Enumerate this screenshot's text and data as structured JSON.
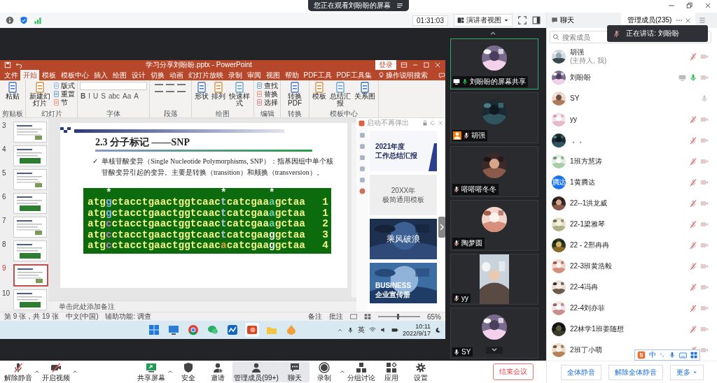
{
  "header": {
    "banner": "您正在观看刘盼盼的屏幕"
  },
  "meeting_bar": {
    "timer": "01:31:03",
    "view_mode": "演讲者视图"
  },
  "ppt": {
    "title": "学习分享刘盼盼.pptx - PowerPoint",
    "sign_in": "登录",
    "tabs": [
      {
        "label": "文件",
        "selected": false
      },
      {
        "label": "开始",
        "selected": true
      },
      {
        "label": "模板",
        "selected": false
      },
      {
        "label": "模板中心",
        "selected": false
      },
      {
        "label": "插入",
        "selected": false
      },
      {
        "label": "绘图",
        "selected": false
      },
      {
        "label": "设计",
        "selected": false
      },
      {
        "label": "切换",
        "selected": false
      },
      {
        "label": "动画",
        "selected": false
      },
      {
        "label": "幻灯片放映",
        "selected": false
      },
      {
        "label": "录制",
        "selected": false
      },
      {
        "label": "审阅",
        "selected": false
      },
      {
        "label": "视图",
        "selected": false
      },
      {
        "label": "帮助",
        "selected": false
      },
      {
        "label": "PDF工具",
        "selected": false
      },
      {
        "label": "PDF工具集",
        "selected": false
      }
    ],
    "tell_me": "操作说明搜索",
    "ribbon": [
      {
        "label": "剪贴板",
        "buttons": [
          {
            "label": "粘贴",
            "kind": "large"
          }
        ]
      },
      {
        "label": "幻灯片",
        "buttons": [
          {
            "label": "新建幻灯片",
            "kind": "large"
          },
          {
            "label": "版式",
            "kind": "small"
          },
          {
            "label": "重置",
            "kind": "small"
          },
          {
            "label": "节",
            "kind": "small"
          }
        ]
      },
      {
        "label": "字体",
        "buttons": [
          {
            "label": "B",
            "kind": "glyph"
          },
          {
            "label": "I",
            "kind": "glyph"
          },
          {
            "label": "U",
            "kind": "glyph"
          },
          {
            "label": "S",
            "kind": "glyph"
          },
          {
            "label": "abc",
            "kind": "glyph"
          },
          {
            "label": "Aa",
            "kind": "glyph"
          },
          {
            "label": "A",
            "kind": "glyph"
          }
        ]
      },
      {
        "label": "段落"
      },
      {
        "label": "绘图",
        "buttons": [
          {
            "label": "形状",
            "kind": "large"
          },
          {
            "label": "排列",
            "kind": "large"
          },
          {
            "label": "快速样式",
            "kind": "large"
          }
        ]
      },
      {
        "label": "编辑",
        "buttons": [
          {
            "label": "查找",
            "kind": "small"
          },
          {
            "label": "替换",
            "kind": "small"
          },
          {
            "label": "选择",
            "kind": "small"
          }
        ]
      },
      {
        "label": "转换",
        "buttons": [
          {
            "label": "转换PDF",
            "kind": "large"
          }
        ]
      },
      {
        "label": "模板中心",
        "buttons": [
          {
            "label": "模板",
            "kind": "large"
          },
          {
            "label": "总结汇报",
            "kind": "large"
          },
          {
            "label": "关系图",
            "kind": "large"
          }
        ]
      }
    ],
    "thumbnails": [
      {
        "number": "3",
        "selected": false
      },
      {
        "number": "4",
        "selected": false
      },
      {
        "number": "5",
        "selected": false
      },
      {
        "number": "6",
        "selected": false
      },
      {
        "number": "7",
        "selected": false
      },
      {
        "number": "8",
        "selected": false
      },
      {
        "number": "9",
        "selected": true
      },
      {
        "number": "10",
        "selected": false
      }
    ],
    "slide": {
      "title": "2.3 分子标记 ——SNP",
      "bullet": "✓",
      "text": "单核苷酸变异（Single Nucleotide Polymorphisms, SNP）：指基因组中单个核苷酸变异引起的变异。主要是转换（transition）和颠换（transversion）。",
      "marker_row": "   *                  *       *",
      "sequences": [
        {
          "number": "1",
          "segments": [
            {
              "text": "atg"
            },
            {
              "text": "g",
              "color": "#8ab4f8"
            },
            {
              "text": "ctacctgaactggtcaac"
            },
            {
              "text": "t",
              "color": "#b0c4de"
            },
            {
              "text": "catcgaa"
            },
            {
              "text": "a",
              "color": "#66cdaa"
            },
            {
              "text": "gctaa"
            }
          ]
        },
        {
          "number": "1",
          "segments": [
            {
              "text": "atg"
            },
            {
              "text": "g",
              "color": "#8ab4f8"
            },
            {
              "text": "ctacctgaactggtcaac"
            },
            {
              "text": "t",
              "color": "#b0c4de"
            },
            {
              "text": "catcgaa"
            },
            {
              "text": "a",
              "color": "#66cdaa"
            },
            {
              "text": "gctaa"
            }
          ]
        },
        {
          "number": "2",
          "segments": [
            {
              "text": "atg"
            },
            {
              "text": "c",
              "color": "#b07cc6"
            },
            {
              "text": "ctacctgaactggtcaac"
            },
            {
              "text": "t",
              "color": "#b0c4de"
            },
            {
              "text": "catcgaa"
            },
            {
              "text": "a",
              "color": "#66cdaa"
            },
            {
              "text": "gctaa"
            }
          ]
        },
        {
          "number": "3",
          "segments": [
            {
              "text": "atg"
            },
            {
              "text": "c",
              "color": "#b07cc6"
            },
            {
              "text": "ctacctgaactggtcaac"
            },
            {
              "text": "t",
              "color": "#b0c4de"
            },
            {
              "text": "catcgaa"
            },
            {
              "text": "g",
              "color": "#f4f4f4"
            },
            {
              "text": "gctaa"
            }
          ]
        },
        {
          "number": "4",
          "segments": [
            {
              "text": "atg"
            },
            {
              "text": "c",
              "color": "#b07cc6"
            },
            {
              "text": "ctacctgaactggtcaac"
            },
            {
              "text": "a",
              "color": "#d9a441"
            },
            {
              "text": "catcgaa"
            },
            {
              "text": "g",
              "color": "#f4f4f4"
            },
            {
              "text": "gctaa"
            }
          ]
        }
      ]
    },
    "notes": "单击此处添加备注",
    "template_pane": {
      "notice": "启动不再弹出",
      "cards": [
        {
          "kind": "report",
          "lines": [
            "2021年度",
            "工作总结汇报"
          ]
        },
        {
          "kind": "minimal",
          "lines": [
            "20XX年",
            "极简通用模板"
          ]
        },
        {
          "kind": "brush",
          "lines": [
            "乘风破浪"
          ]
        },
        {
          "kind": "city",
          "lines": [
            "BUSINESS",
            "企业宣传册"
          ]
        }
      ]
    },
    "status": {
      "slide_info": "第 9 张，共 19 张",
      "language": "中文(中国)",
      "accessibility": "辅助功能: 调查",
      "notes": "备注",
      "comments": "批注",
      "zoom": "65%",
      "zoom_slider": {
        "level": 0.45
      }
    }
  },
  "taskbar": {
    "apps": [
      {
        "kind": "start",
        "selected": false
      },
      {
        "kind": "desktop",
        "selected": false
      },
      {
        "kind": "browser",
        "selected": false
      },
      {
        "kind": "chat",
        "selected": false
      },
      {
        "kind": "board",
        "selected": false
      },
      {
        "kind": "slides",
        "selected": true
      },
      {
        "kind": "folder",
        "selected": false
      },
      {
        "kind": "flame",
        "selected": false
      }
    ],
    "input_method": "英",
    "time": "10:11",
    "date": "2022/9/17"
  },
  "video_tiles": [
    {
      "name": "刘盼盼的屏幕共享",
      "kind": "avatar",
      "speaking": true,
      "sharing": true,
      "host": false,
      "muted": false
    },
    {
      "name": "胡强",
      "kind": "avatar",
      "speaking": false,
      "sharing": false,
      "host": true,
      "muted": true
    },
    {
      "name": "嗒嗒嗒冬冬",
      "kind": "avatar",
      "speaking": false,
      "sharing": false,
      "host": false,
      "muted": true
    },
    {
      "name": "陶梦圆",
      "kind": "avatar",
      "speaking": false,
      "sharing": false,
      "host": false,
      "muted": true
    },
    {
      "name": "yy",
      "kind": "video",
      "speaking": false,
      "sharing": false,
      "host": false,
      "muted": true
    },
    {
      "name": "SY",
      "kind": "avatar",
      "speaking": false,
      "sharing": false,
      "host": false,
      "muted": false
    }
  ],
  "panel": {
    "tabs": [
      {
        "label": "聊天",
        "kind": "chat",
        "selected": false
      },
      {
        "label": "管理成员(235)",
        "kind": "members",
        "selected": true
      }
    ],
    "search_placeholder": "搜索成员",
    "speaking_toast": "正在讲话: 刘盼盼",
    "members": [
      {
        "name": "胡强",
        "role": "(主持人, 我)",
        "sharing": false,
        "talking": false,
        "muted": true,
        "video_off": true
      },
      {
        "name": "刘盼盼",
        "sharing": true,
        "talking": true,
        "muted": false,
        "video_off": true
      },
      {
        "name": "SY",
        "sharing": false,
        "talking": false,
        "muted": false,
        "video_off": false
      },
      {
        "name": "yy",
        "sharing": false,
        "talking": false,
        "muted": true,
        "video_off": true
      },
      {
        "name": "，，",
        "sharing": false,
        "talking": false,
        "muted": true,
        "video_off": true
      },
      {
        "name": "1班方慧涛",
        "sharing": false,
        "talking": false,
        "muted": true,
        "video_off": true
      },
      {
        "name": "1黄腾达",
        "avatar": {
          "kind": "text",
          "text": "腾达"
        },
        "sharing": false,
        "talking": false,
        "muted": true,
        "video_off": true
      },
      {
        "name": "22--1洪龙威",
        "sharing": false,
        "talking": false,
        "muted": true,
        "video_off": true
      },
      {
        "name": "22-1梁雅琴",
        "sharing": false,
        "talking": false,
        "muted": true,
        "video_off": true
      },
      {
        "name": "22 - 2邢冉冉",
        "sharing": false,
        "talking": false,
        "muted": true,
        "video_off": true
      },
      {
        "name": "22-3班黄浩毅",
        "sharing": false,
        "talking": false,
        "muted": true,
        "video_off": true
      },
      {
        "name": "22-4冯冉",
        "sharing": false,
        "talking": false,
        "muted": true,
        "video_off": true
      },
      {
        "name": "22-4刘亦菲",
        "sharing": false,
        "talking": false,
        "muted": true,
        "video_off": true
      },
      {
        "name": "22林学1班姜随想",
        "sharing": false,
        "talking": false,
        "muted": true,
        "video_off": true
      },
      {
        "name": "2班丁小萌",
        "sharing": false,
        "talking": false,
        "muted": true,
        "video_off": true
      }
    ],
    "buttons": [
      {
        "label": "全体静音",
        "menu": false
      },
      {
        "label": "解除全体静音",
        "menu": false
      },
      {
        "label": "更多",
        "menu": true
      }
    ],
    "ime": {
      "mode": "中"
    }
  },
  "toolbar": {
    "items": [
      {
        "label": "解除静音",
        "kind": "unmute",
        "menu": true,
        "selected": false
      },
      {
        "label": "开启视频",
        "kind": "video",
        "menu": true,
        "selected": false
      },
      {
        "label": "共享屏幕",
        "kind": "share",
        "menu": true,
        "selected": false
      },
      {
        "label": "安全",
        "kind": "security",
        "menu": false,
        "selected": false
      },
      {
        "label": "邀请",
        "kind": "invite",
        "menu": false,
        "selected": false
      },
      {
        "label": "管理成员(99+)",
        "kind": "members",
        "menu": false,
        "selected": true
      },
      {
        "label": "聊天",
        "kind": "chat",
        "menu": false,
        "selected": true
      },
      {
        "label": "录制",
        "kind": "record",
        "menu": true,
        "selected": false
      },
      {
        "label": "分组讨论",
        "kind": "breakout",
        "menu": false,
        "selected": false
      },
      {
        "label": "应用",
        "kind": "apps",
        "menu": false,
        "selected": false
      },
      {
        "label": "设置",
        "kind": "settings",
        "menu": false,
        "selected": false
      }
    ],
    "end_button": "结束会议"
  }
}
